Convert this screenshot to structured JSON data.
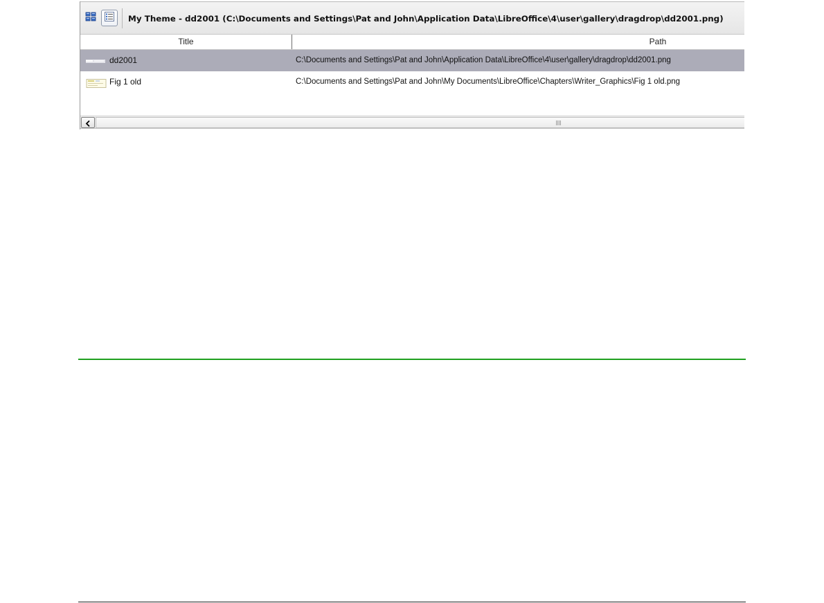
{
  "gallery": {
    "theme_title": "My Theme - dd2001 (C:\\Documents and Settings\\Pat and John\\Application Data\\LibreOffice\\4\\user\\gallery\\dragdrop\\dd2001.png)",
    "view_buttons": {
      "icon_view": "grid-view-icon",
      "detail_view": "detail-list-view-icon",
      "active": "detail_view"
    },
    "columns": {
      "title": "Title",
      "path": "Path"
    },
    "rows": [
      {
        "title": "dd2001",
        "path": "C:\\Documents and Settings\\Pat and John\\Application Data\\LibreOffice\\4\\user\\gallery\\dragdrop\\dd2001.png",
        "selected": true,
        "thumbnail": "dd2001-thumbnail"
      },
      {
        "title": "Fig 1 old",
        "path": "C:\\Documents and Settings\\Pat and John\\My Documents\\LibreOffice\\Chapters\\Writer_Graphics\\Fig 1 old.png",
        "selected": false,
        "thumbnail": "fig-1-old-thumbnail"
      }
    ],
    "scrollbar": {
      "left_arrow": "chevron-left-icon",
      "position": 0
    }
  },
  "colors": {
    "selected_row": "#acacb8",
    "green_rule": "#1fa01f",
    "dark_rule": "#222222"
  }
}
